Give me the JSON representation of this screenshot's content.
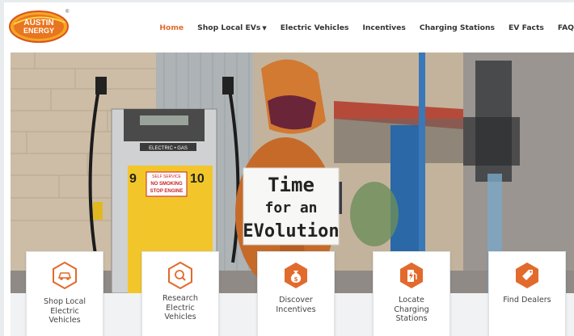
{
  "brand": {
    "logo_line1": "AUSTIN",
    "logo_line2": "ENERGY",
    "logo_mark": "®"
  },
  "nav": {
    "items": [
      {
        "label": "Home",
        "active": true
      },
      {
        "label": "Shop Local EVs",
        "has_dropdown": true
      },
      {
        "label": "Electric Vehicles"
      },
      {
        "label": "Incentives"
      },
      {
        "label": "Charging Stations"
      },
      {
        "label": "EV Facts"
      },
      {
        "label": "FAQ"
      }
    ]
  },
  "hero": {
    "sign_line1": "Time",
    "sign_line2": "for an",
    "sign_line3": "EVolution",
    "pump_number_left": "9",
    "pump_number_right": "10",
    "pump_sticker_line1": "SELF SERVICE",
    "pump_sticker_line2": "NO SMOKING",
    "pump_sticker_line3": "STOP ENGINE",
    "pump_badge": "ELECTRIC • GAS"
  },
  "cards": [
    {
      "icon": "car-icon",
      "lines": [
        "Shop Local",
        "Electric",
        "Vehicles"
      ]
    },
    {
      "icon": "search-icon",
      "lines": [
        "Research",
        "Electric",
        "Vehicles"
      ]
    },
    {
      "icon": "money-bag-icon",
      "lines": [
        "Discover",
        "Incentives"
      ]
    },
    {
      "icon": "charging-station-icon",
      "lines": [
        "Locate",
        "Charging",
        "Stations"
      ]
    },
    {
      "icon": "tag-icon",
      "lines": [
        "Find Dealers"
      ]
    }
  ],
  "colors": {
    "accent": "#e26a2c",
    "nav_text": "#333333",
    "card_text": "#444444"
  }
}
